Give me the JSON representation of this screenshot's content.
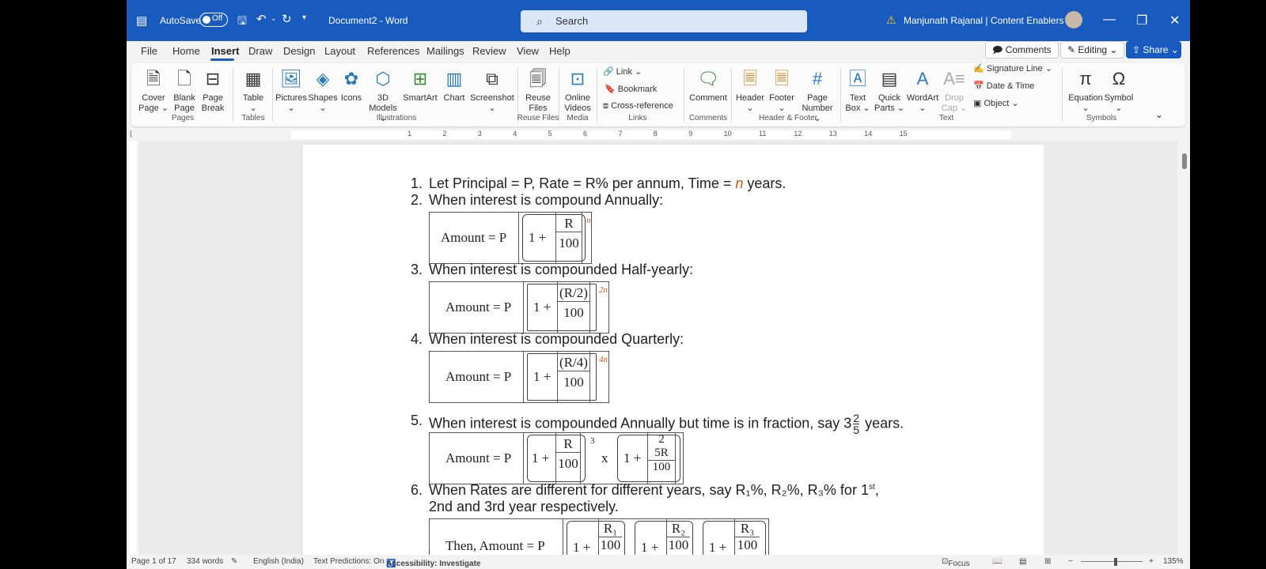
{
  "titlebar": {
    "autosave": "AutoSave",
    "toggle": "Off",
    "doc": "Document2  -  Word",
    "search": "Search",
    "user": "Manjunath Rajanal | Content Enablers"
  },
  "menu": {
    "items": [
      "File",
      "Home",
      "Insert",
      "Draw",
      "Design",
      "Layout",
      "References",
      "Mailings",
      "Review",
      "View",
      "Help"
    ],
    "comments": "Comments",
    "editing": "Editing",
    "share": "Share"
  },
  "ribbon": {
    "pages": {
      "cover1": "Cover",
      "cover2": "Page",
      "blank1": "Blank",
      "blank2": "Page",
      "break1": "Page",
      "break2": "Break",
      "group": "Pages"
    },
    "tables": {
      "table": "Table",
      "group": "Tables"
    },
    "illus": {
      "pictures": "Pictures",
      "shapes": "Shapes",
      "icons": "Icons",
      "models1": "3D",
      "models2": "Models",
      "smartart": "SmartArt",
      "chart": "Chart",
      "screenshot": "Screenshot",
      "group": "Illustrations"
    },
    "reuse": {
      "r1": "Reuse",
      "r2": "Files",
      "group": "Reuse Files"
    },
    "media": {
      "m1": "Online",
      "m2": "Videos",
      "group": "Media"
    },
    "links": {
      "link": "Link",
      "bookmark": "Bookmark",
      "cross": "Cross-reference",
      "group": "Links"
    },
    "comments": {
      "comment": "Comment",
      "group": "Comments"
    },
    "hf": {
      "header": "Header",
      "footer": "Footer",
      "pn1": "Page",
      "pn2": "Number",
      "group": "Header & Footer"
    },
    "text": {
      "tb1": "Text",
      "tb2": "Box",
      "qp1": "Quick",
      "qp2": "Parts",
      "wordart": "WordArt",
      "dc1": "Drop",
      "dc2": "Cap",
      "sig": "Signature Line",
      "date": "Date & Time",
      "object": "Object",
      "group": "Text"
    },
    "symbols": {
      "equation": "Equation",
      "symbol": "Symbol",
      "group": "Symbols"
    }
  },
  "ruler": {
    "ticks": [
      "1",
      "2",
      "3",
      "4",
      "5",
      "6",
      "7",
      "8",
      "9",
      "10",
      "11",
      "12",
      "13",
      "14",
      "15"
    ]
  },
  "doc": {
    "l1": "Let Principal = P, Rate = R% per annum, Time = ",
    "l1n": "n",
    "l1end": " years.",
    "l2": "When interest is compound Annually:",
    "l3": "When interest is compounded Half-yearly:",
    "l4": "When interest is compounded Quarterly:",
    "l5": "When interest is compounded Annually but time is in fraction, say 3",
    "l5end": " years.",
    "l5num": "2",
    "l5den": "5",
    "l6a": "When Rates are different for different years, say R",
    "l6b": "2nd and 3rd year respectively.",
    "amount": "Amount = P",
    "then": "Then, Amount = P",
    "one": "1 +",
    "R": "R",
    "h": "100",
    "R2": "(R/2)",
    "R4": "(R/4)",
    "e1": "n",
    "e2": "2n",
    "e3": "4n",
    "e5": "3",
    "x": "x",
    "f2": "2",
    "f5R": "5R",
    "R1": "R₁",
    "R2s": "R₂",
    "R3s": "R₃",
    "nums": [
      "1.",
      "2.",
      "3.",
      "4.",
      "5.",
      "6."
    ],
    "l6full": "When Rates are different for different years, say R₁%, R₂%, R₃% for 1",
    "st": "st",
    "l6c": ","
  },
  "status": {
    "page": "Page 1 of 17",
    "words": "334 words",
    "lang": "English (India)",
    "pred": "Text Predictions: On",
    "acc": "Accessibility: Investigate",
    "focus": "Focus",
    "zoom": "135%"
  }
}
